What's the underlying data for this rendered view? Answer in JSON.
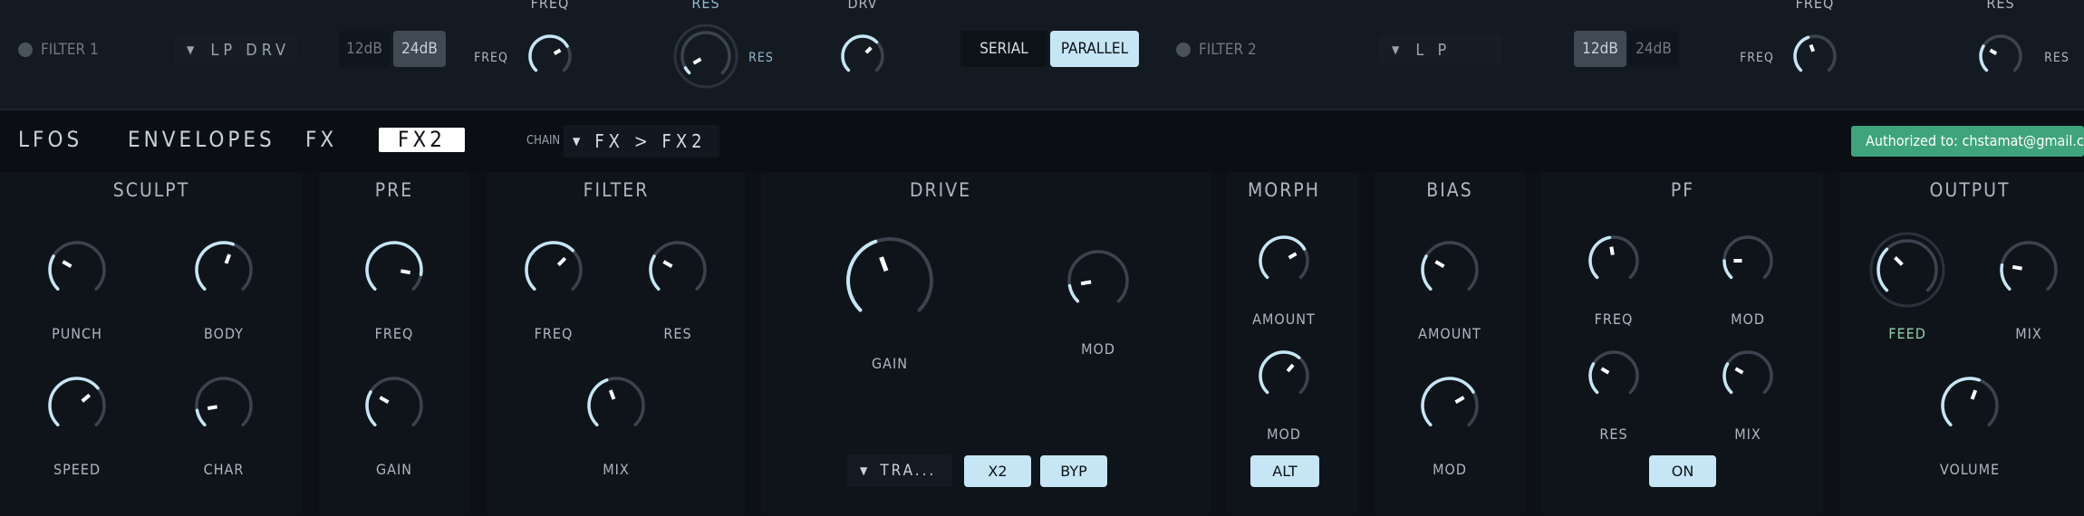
{
  "topbar": {
    "filter1": {
      "toggle_label": "FILTER 1",
      "type": "LP DRV",
      "slope_a": "12dB",
      "slope_b": "24dB",
      "freq_top": "FREQ",
      "freq_label": "FREQ",
      "res_top": "RES",
      "res_label": "RES",
      "drv_top": "DRV"
    },
    "routing": {
      "serial": "SERIAL",
      "parallel": "PARALLEL"
    },
    "filter2": {
      "toggle_label": "FILTER 2",
      "type": "L P",
      "slope_a": "12dB",
      "slope_b": "24dB",
      "freq_top": "FREQ",
      "freq_label": "FREQ",
      "res_top": "RES",
      "res_label": "RES"
    }
  },
  "nav": {
    "tabs": [
      "LFOS",
      "ENVELOPES",
      "FX",
      "FX2"
    ],
    "active_tab": "FX2",
    "chain_label": "CHAIN",
    "chain_value": "FX > FX2",
    "auth": "Authorized to: chstamat@gmail.com"
  },
  "sections": {
    "sculpt": {
      "title": "SCULPT",
      "punch": "PUNCH",
      "body": "BODY",
      "speed": "SPEED",
      "char": "CHAR"
    },
    "pre": {
      "title": "PRE",
      "freq": "FREQ",
      "gain": "GAIN"
    },
    "filter": {
      "title": "FILTER",
      "freq": "FREQ",
      "res": "RES",
      "mix": "MIX"
    },
    "drive": {
      "title": "DRIVE",
      "gain": "GAIN",
      "mod": "MOD",
      "mode": "TRA...",
      "x2": "X2",
      "byp": "BYP"
    },
    "morph": {
      "title": "MORPH",
      "amount": "AMOUNT",
      "mod": "MOD",
      "alt": "ALT"
    },
    "bias": {
      "title": "BIAS",
      "amount": "AMOUNT",
      "mod": "MOD"
    },
    "pf": {
      "title": "PF",
      "freq": "FREQ",
      "mod": "MOD",
      "res": "RES",
      "mix": "MIX",
      "on": "ON"
    },
    "output": {
      "title": "OUTPUT",
      "feed": "FEED",
      "mix": "MIX",
      "volume": "VOLUME"
    }
  },
  "colors": {
    "accent": "#c6e6f5",
    "auth_bg": "#3fa37b",
    "feed_label": "#8fd0a8",
    "panel": "#0f141a"
  }
}
